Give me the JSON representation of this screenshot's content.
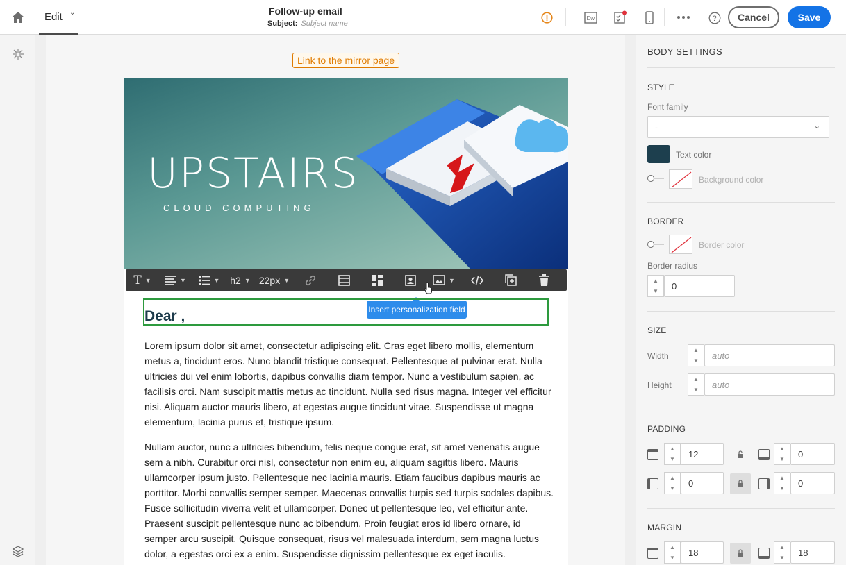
{
  "header": {
    "mode_label": "Edit",
    "title": "Follow-up email",
    "subject_label": "Subject:",
    "subject_value": "Subject name",
    "cancel_label": "Cancel",
    "save_label": "Save",
    "icons": [
      "home-icon",
      "chevron-down-icon",
      "warning-icon",
      "dreamweaver-icon",
      "checklist-icon",
      "mobile-icon",
      "more-icon",
      "help-icon"
    ]
  },
  "email": {
    "mirror_link": "Link to the mirror page",
    "banner_title": "UPSTAIRS",
    "banner_subtitle": "CLOUD COMPUTING",
    "toolbar": {
      "heading": "h2",
      "size": "22px"
    },
    "tooltip": "Insert personalization field",
    "greeting": "Dear ,",
    "paragraphs": [
      "Lorem ipsum dolor sit amet, consectetur adipiscing elit. Cras eget libero mollis, elementum metus a, tincidunt eros. Nunc blandit tristique consequat. Pellentesque at pulvinar erat. Nulla ultricies dui vel enim lobortis, dapibus convallis diam tempor. Nunc a vestibulum sapien, ac facilisis orci. Nam suscipit mattis metus ac tincidunt. Nulla sed risus magna. Integer vel efficitur nisi. Aliquam auctor mauris libero, at egestas augue tincidunt vitae. Suspendisse ut magna elementum, lacinia purus et, tristique ipsum.",
      "Nullam auctor, nunc a ultricies bibendum, felis neque congue erat, sit amet venenatis augue sem a nibh. Curabitur orci nisl, consectetur non enim eu, aliquam sagittis libero. Mauris ullamcorper ipsum justo. Pellentesque nec lacinia mauris. Etiam faucibus dapibus mauris ac porttitor. Morbi convallis semper semper. Maecenas convallis turpis sed turpis sodales dapibus. Fusce sollicitudin viverra velit et ullamcorper. Donec ut pellentesque leo, vel efficitur ante. Praesent suscipit pellentesque nunc ac bibendum. Proin feugiat eros id libero ornare, id semper arcu suscipit. Quisque consequat, risus vel malesuada interdum, sem magna luctus dolor, a egestas orci ex a enim. Suspendisse dignissim pellentesque ex eget iaculis."
    ]
  },
  "panel": {
    "title": "BODY SETTINGS",
    "style": {
      "heading": "STYLE",
      "font_family_label": "Font family",
      "font_family_value": "-",
      "text_color_label": "Text color",
      "text_color": "#1d3f4e",
      "background_color_label": "Background color"
    },
    "border": {
      "heading": "BORDER",
      "border_color_label": "Border color",
      "border_radius_label": "Border radius",
      "border_radius_value": "0"
    },
    "size": {
      "heading": "SIZE",
      "width_label": "Width",
      "width_placeholder": "auto",
      "height_label": "Height",
      "height_placeholder": "auto"
    },
    "padding": {
      "heading": "PADDING",
      "top": "12",
      "bottom": "0",
      "left": "0",
      "right": "0"
    },
    "margin": {
      "heading": "MARGIN",
      "top": "18",
      "bottom": "18"
    }
  },
  "colors": {
    "accent": "#1473e6",
    "warning": "#e68619",
    "selection": "#2d9a3e",
    "tooltip": "#2d8ceb"
  }
}
